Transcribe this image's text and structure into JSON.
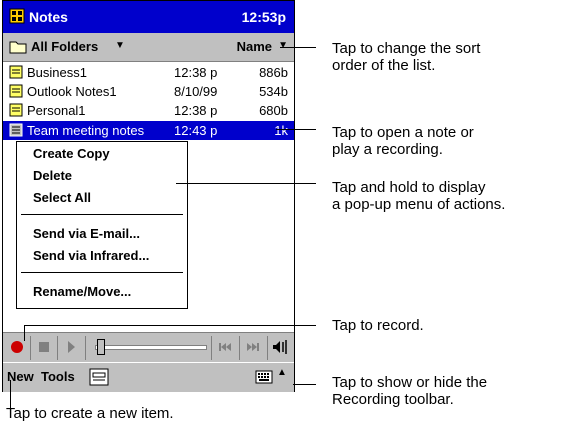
{
  "app": {
    "title": "Notes",
    "time": "12:53p"
  },
  "folder_bar": {
    "folder_label": "All Folders",
    "sort_label": "Name"
  },
  "notes": [
    {
      "name": "Business1",
      "time": "12:38 p",
      "size": "886b"
    },
    {
      "name": "Outlook Notes1",
      "time": "8/10/99",
      "size": "534b"
    },
    {
      "name": "Personal1",
      "time": "12:38 p",
      "size": "680b"
    },
    {
      "name": "Team meeting notes",
      "time": "12:43 p",
      "size": "1k"
    }
  ],
  "popup_menu": {
    "items": [
      "Create Copy",
      "Delete",
      "Select All",
      "Send via E-mail...",
      "Send via Infrared...",
      "Rename/Move..."
    ]
  },
  "menu_bar": {
    "new_label": "New",
    "tools_label": "Tools"
  },
  "callouts": {
    "sort": "Tap to change the sort order of the list.",
    "sort_line1": "Tap to change the sort",
    "sort_line2": "order of the list.",
    "open_line1": "Tap to open a note or",
    "open_line2": "play a recording.",
    "hold_line1": "Tap and hold to display",
    "hold_line2": "a pop-up menu of actions.",
    "record": "Tap to record.",
    "toolbar_line1": "Tap to show or hide the",
    "toolbar_line2": "Recording toolbar.",
    "new_item": "Tap to create a new item."
  },
  "colors": {
    "title_bar": "#0000cc",
    "selection": "#0000cc",
    "chrome": "#c0c0c0",
    "record_button": "#cc0000"
  },
  "icons": [
    "notes-app-icon",
    "folder-icon",
    "note-icon",
    "recording-icon",
    "record-icon",
    "stop-icon",
    "play-icon",
    "rewind-icon",
    "fast-forward-icon",
    "volume-icon",
    "keyboard-icon",
    "toggle-toolbar-icon"
  ]
}
